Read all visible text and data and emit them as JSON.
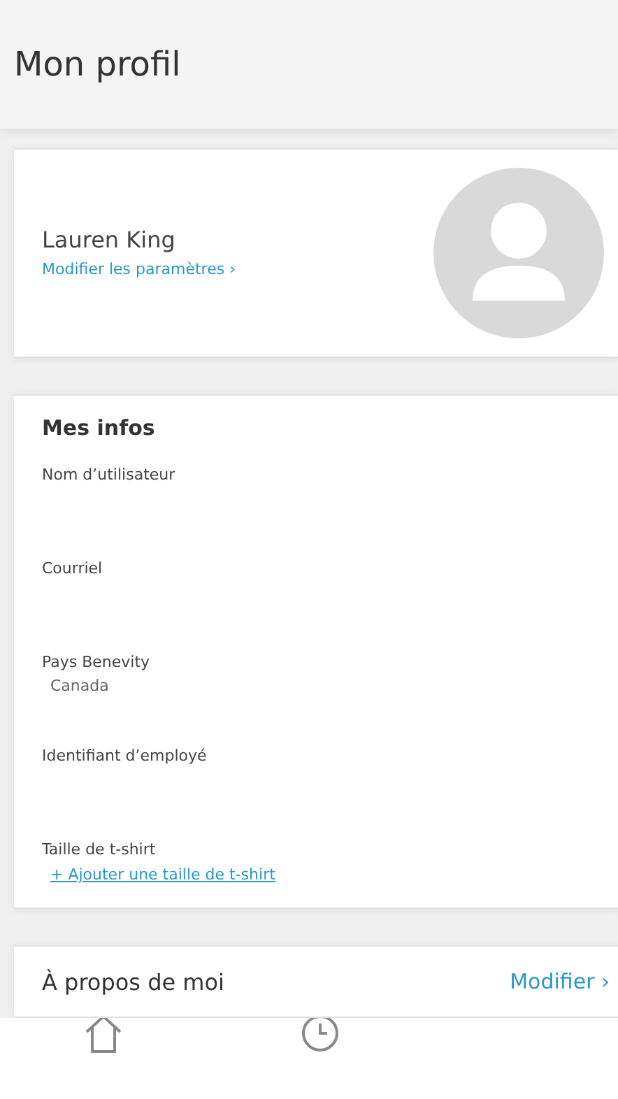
{
  "header": {
    "title": "Mon profil"
  },
  "profile": {
    "name": "Lauren King",
    "settings_link": "Modifier les paramètres",
    "link_chevron": "›"
  },
  "info": {
    "title": "Mes infos",
    "fields": [
      {
        "label": "Nom d’utilisateur",
        "kind": "empty"
      },
      {
        "label": "Courriel",
        "kind": "empty"
      },
      {
        "label": "Pays Benevity",
        "kind": "value",
        "value": "Canada"
      },
      {
        "label": "Identifiant d’employé",
        "kind": "empty"
      },
      {
        "label": "Taille de t-shirt",
        "kind": "link",
        "value": "+ Ajouter une taille de t-shirt"
      }
    ]
  },
  "about": {
    "title": "À propos de moi",
    "edit": "Modifier",
    "edit_chevron": "›"
  },
  "tab_bar": {
    "items": [
      {
        "kind": "home"
      },
      {
        "kind": "clock"
      }
    ]
  }
}
